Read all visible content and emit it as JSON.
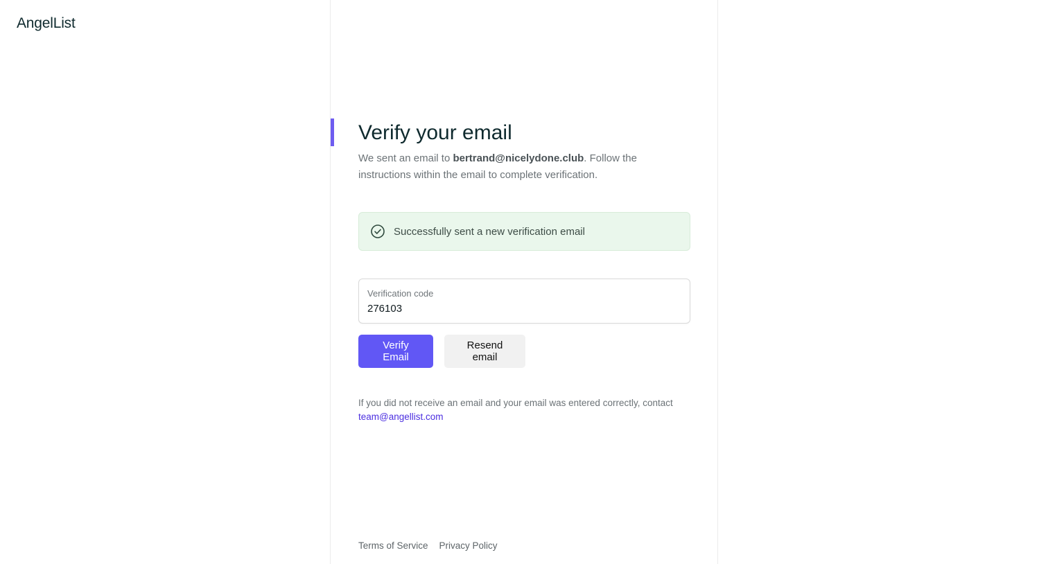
{
  "brand": {
    "logo_text": "AngelList"
  },
  "main": {
    "title": "Verify your email",
    "subtitle_prefix": "We sent an email to ",
    "email": "bertrand@nicelydone.club",
    "subtitle_suffix": ". Follow the instructions within the email to complete verification."
  },
  "alert": {
    "icon": "check-circle-icon",
    "message": "Successfully sent a new verification email"
  },
  "form": {
    "code_label": "Verification code",
    "code_value": "276103",
    "verify_label": "Verify Email",
    "resend_label": "Resend email"
  },
  "help": {
    "text": "If you did not receive an email and your email was entered correctly, contact",
    "contact_email": "team@angellist.com"
  },
  "footer": {
    "terms_label": "Terms of Service",
    "privacy_label": "Privacy Policy"
  },
  "colors": {
    "accent": "#6157f5",
    "success_bg": "#eaf7ec",
    "link": "#4b2ee0"
  }
}
